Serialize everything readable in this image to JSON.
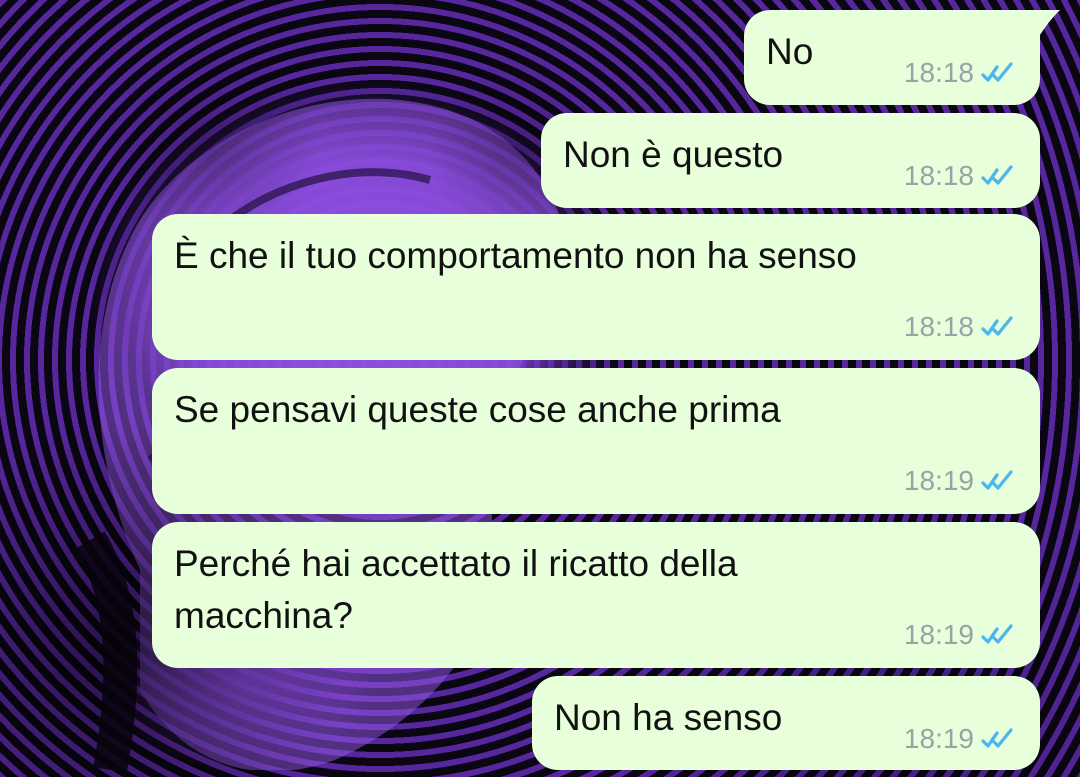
{
  "chat": {
    "messages": [
      {
        "text": "No",
        "time": "18:18",
        "status_icon": "double-check-icon"
      },
      {
        "text": "Non è questo",
        "time": "18:18",
        "status_icon": "double-check-icon"
      },
      {
        "text": "È che il tuo comportamento non ha senso",
        "time": "18:18",
        "status_icon": "double-check-icon"
      },
      {
        "text": "Se pensavi queste cose anche prima",
        "time": "18:19",
        "status_icon": "double-check-icon"
      },
      {
        "text": "Perché hai accettato il ricatto della\nmacchina?",
        "time": "18:19",
        "status_icon": "double-check-icon"
      },
      {
        "text": "Non ha senso",
        "time": "18:19",
        "status_icon": "double-check-icon"
      }
    ]
  },
  "colors": {
    "bubble_background": "#e7ffdb",
    "timestamp": "#98a3a6",
    "read_receipt": "#4fb6ec",
    "wallpaper_accent": "#8b4ee6"
  }
}
